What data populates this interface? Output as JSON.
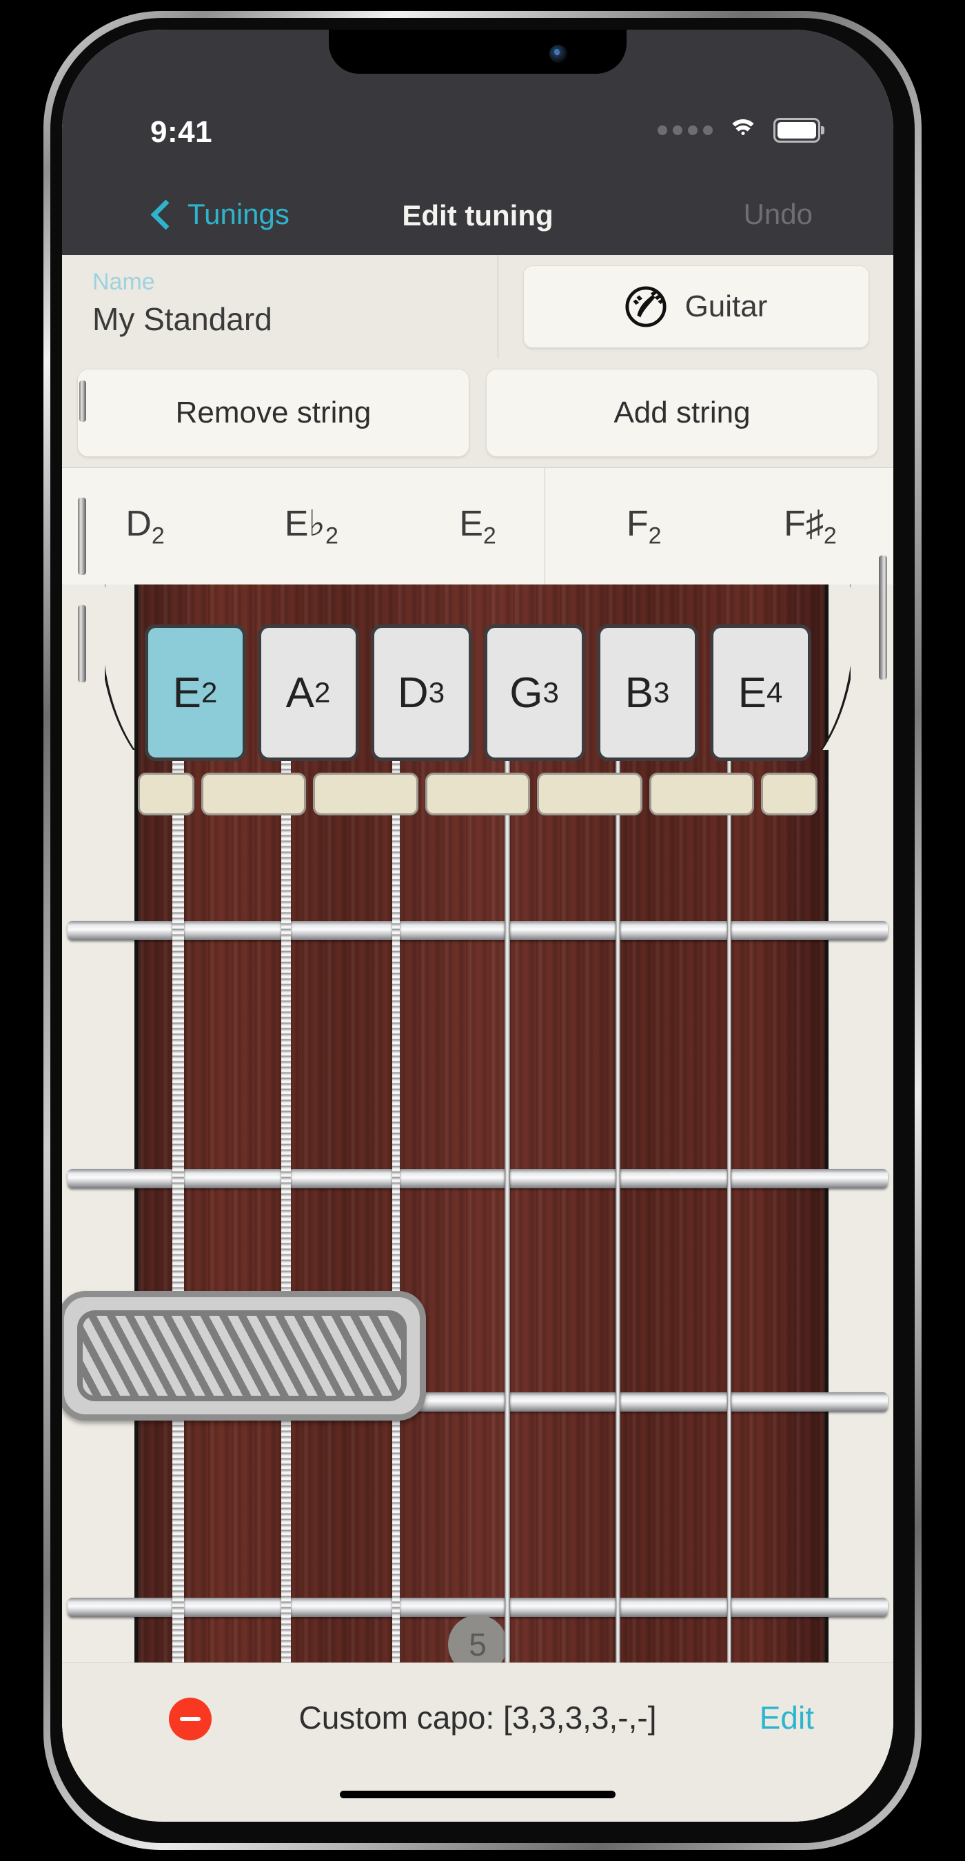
{
  "status_bar": {
    "time": "9:41",
    "signal_icon": "signal-dots-icon",
    "wifi_icon": "wifi-icon",
    "battery_icon": "battery-icon"
  },
  "nav": {
    "back_label": "Tunings",
    "back_icon": "chevron-left-icon",
    "title": "Edit tuning",
    "undo_label": "Undo"
  },
  "name_row": {
    "label": "Name",
    "value": "My Standard",
    "instrument_label": "Guitar",
    "instrument_icon": "guitar-headstock-icon"
  },
  "string_buttons": {
    "remove_label": "Remove string",
    "add_label": "Add string"
  },
  "note_picker": {
    "options": [
      {
        "note": "D",
        "octave": "2"
      },
      {
        "note": "E♭",
        "octave": "2"
      },
      {
        "note": "E",
        "octave": "2"
      },
      {
        "note": "F",
        "octave": "2"
      },
      {
        "note": "F♯",
        "octave": "2"
      }
    ]
  },
  "strings": [
    {
      "note": "E",
      "octave": "2",
      "selected": true,
      "wound": true
    },
    {
      "note": "A",
      "octave": "2",
      "selected": false,
      "wound": true
    },
    {
      "note": "D",
      "octave": "3",
      "selected": false,
      "wound": true
    },
    {
      "note": "G",
      "octave": "3",
      "selected": false,
      "wound": false
    },
    {
      "note": "B",
      "octave": "3",
      "selected": false,
      "wound": false
    },
    {
      "note": "E",
      "octave": "4",
      "selected": false,
      "wound": false
    }
  ],
  "fretboard": {
    "fret_marker_label": "5",
    "capo_covered_strings": 4
  },
  "toolbar": {
    "remove_icon": "minus-circle-icon",
    "capo_text": "Custom capo: [3,3,3,3,-,-]",
    "edit_label": "Edit"
  },
  "colors": {
    "accent": "#2eb5ce",
    "selected_tab": "#8ccbd8",
    "remove_red": "#f93822",
    "navbar_bg": "#39393d",
    "panel_bg": "#ebe9e2",
    "fretboard_wood": "#5a2720"
  }
}
